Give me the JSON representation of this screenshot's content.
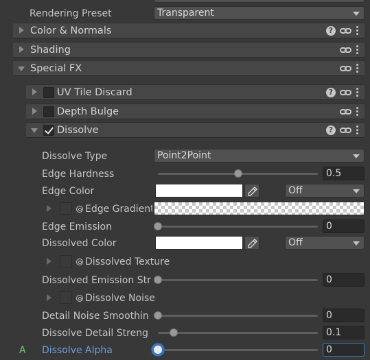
{
  "top": {
    "rendering_preset": {
      "label": "Rendering Preset",
      "value": "Transparent"
    }
  },
  "sections": {
    "color_normals": "Color & Normals",
    "shading": "Shading",
    "special_fx": "Special FX"
  },
  "special_fx": {
    "uv_tile_discard": {
      "title": "UV Tile Discard",
      "checked": false
    },
    "depth_bulge": {
      "title": "Depth Bulge",
      "checked": false
    },
    "dissolve": {
      "title": "Dissolve",
      "checked": true
    }
  },
  "dissolve": {
    "type": {
      "label": "Dissolve Type",
      "value": "Point2Point"
    },
    "edge_hardness": {
      "label": "Edge Hardness",
      "value": "0.5",
      "fraction": 0.5
    },
    "edge_color": {
      "label": "Edge Color",
      "color": "#ffffff",
      "mode": "Off"
    },
    "edge_gradient": {
      "label": "Edge Gradient"
    },
    "edge_emission": {
      "label": "Edge Emission",
      "value": "0",
      "fraction": 0.0
    },
    "dissolved_color": {
      "label": "Dissolved Color",
      "color": "#ffffff",
      "mode": "Off"
    },
    "dissolved_texture": {
      "label": "Dissolved Texture"
    },
    "dissolved_emission_strength": {
      "label": "Dissolved Emission Str",
      "value": "0",
      "fraction": 0.0
    },
    "dissolve_noise": {
      "label": "Dissolve Noise"
    },
    "detail_noise_smoothing": {
      "label": "Detail Noise Smoothin",
      "value": "0",
      "fraction": 0.0
    },
    "dissolve_detail_strength": {
      "label": "Dissolve Detail Streng",
      "value": "0.1",
      "fraction": 0.1
    },
    "dissolve_alpha": {
      "label": "Dissolve Alpha",
      "value": "0",
      "fraction": 0.0,
      "animated_marker": "A"
    }
  },
  "colors": {
    "accent": "#3a79c2",
    "active_label": "#6c9ee0",
    "anim_marker": "#6fcf6f"
  },
  "icons": [
    "help-icon",
    "link-icon",
    "kebab-menu-icon",
    "eyedropper-icon",
    "texture-icon",
    "checkmark-icon",
    "foldout-arrow-icon"
  ]
}
